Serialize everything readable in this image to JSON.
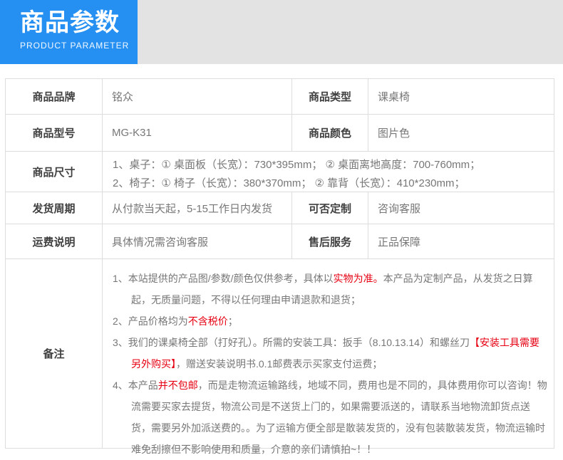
{
  "header": {
    "title": "商品参数",
    "subtitle": "PRODUCT PARAMETER"
  },
  "colors": {
    "accent_blue": "#2590f2",
    "band_gray": "#e3e3e3",
    "border": "#dddddd",
    "label_text": "#404040",
    "value_text": "#777777",
    "red": "#e60012"
  },
  "params": {
    "brand": {
      "label": "商品品牌",
      "value": "铭众"
    },
    "type": {
      "label": "商品类型",
      "value": "课桌椅"
    },
    "model": {
      "label": "商品型号",
      "value": "MG-K31"
    },
    "color": {
      "label": "商品颜色",
      "value": "图片色"
    },
    "size": {
      "label": "商品尺寸",
      "lines": [
        "1、桌子：① 桌面板（长宽）：730*395mm； ② 桌面离地高度：700-760mm；",
        "2、椅子：① 椅子（长宽）：380*370mm； ② 靠背（长宽）：410*230mm；"
      ]
    },
    "delivery": {
      "label": "发货周期",
      "value": "从付款当天起，5-15工作日内发货"
    },
    "custom": {
      "label": "可否定制",
      "value": "咨询客服"
    },
    "shipping": {
      "label": "运费说明",
      "value": "具体情况需咨询客服"
    },
    "aftersale": {
      "label": "售后服务",
      "value": "正品保障"
    },
    "remarks": {
      "label": "备注",
      "items": [
        {
          "segments": [
            {
              "text": "1、本站提供的产品图/参数/颜色仅供参考，具体以",
              "red": false
            },
            {
              "text": "实物为准。",
              "red": true
            },
            {
              "text": "本产品为定制产品，从发货之日算起，无质量问题，不得以任何理由申请退款和退货；",
              "red": false
            }
          ]
        },
        {
          "segments": [
            {
              "text": "2、产品价格均为",
              "red": false
            },
            {
              "text": "不含税价",
              "red": true
            },
            {
              "text": "；",
              "red": false
            }
          ]
        },
        {
          "segments": [
            {
              "text": "3、我们的课桌椅全部（打好孔）。所需的安装工具：扳手（8.10.13.14）和螺丝刀",
              "red": false
            },
            {
              "text": "【安装工具需要另外购买】",
              "red": true
            },
            {
              "text": "，赠送安装说明书.0.1邮费表示买家支付运费；",
              "red": false
            }
          ]
        },
        {
          "segments": [
            {
              "text": "4、本产品",
              "red": false
            },
            {
              "text": "并不包邮",
              "red": true
            },
            {
              "text": "，而是走物流运输路线，地域不同，费用也是不同的，具体费用你可以咨询！物流需要买家去提货，物流公司是不送货上门的，如果需要派送的，请联系当地物流卸货点送货，需要另外加派送费的。。为了运输方便全部是散装发货的，没有包装散装发货，物流运输时难免刮擦但不影响使用和质量，介意的亲们请慎拍~！！",
              "red": false
            }
          ]
        }
      ]
    }
  }
}
